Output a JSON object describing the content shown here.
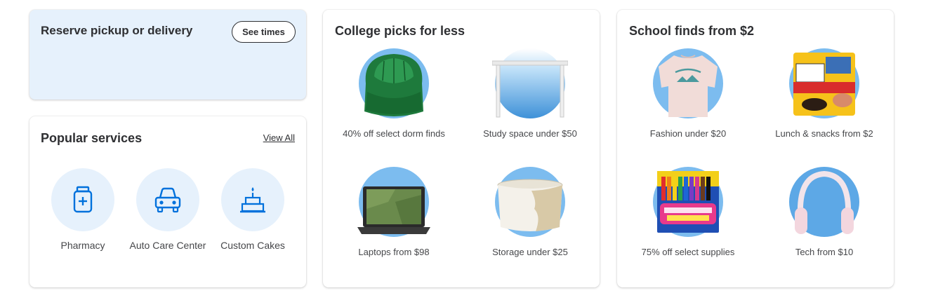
{
  "reserve": {
    "title": "Reserve pickup or delivery",
    "button_label": "See times"
  },
  "services": {
    "title": "Popular services",
    "view_all": "View All",
    "items": [
      {
        "label": "Pharmacy",
        "icon": "pill-bottle-icon"
      },
      {
        "label": "Auto Care Center",
        "icon": "car-icon"
      },
      {
        "label": "Custom Cakes",
        "icon": "cake-icon"
      }
    ]
  },
  "college": {
    "title": "College picks for less",
    "tiles": [
      {
        "label": "40% off select dorm finds",
        "image": "green-bean-bag-chair"
      },
      {
        "label": "Study space under $50",
        "image": "white-desk"
      },
      {
        "label": "Laptops from $98",
        "image": "chromebook-laptop"
      },
      {
        "label": "Storage under $25",
        "image": "fabric-storage-basket"
      }
    ]
  },
  "school": {
    "title": "School finds from $2",
    "tiles": [
      {
        "label": "Fashion under $20",
        "image": "colorado-sweatshirt"
      },
      {
        "label": "Lunch & snacks from $2",
        "image": "lunchables-pack"
      },
      {
        "label": "75% off select supplies",
        "image": "crayola-washable-markers"
      },
      {
        "label": "Tech from $10",
        "image": "pink-headphones"
      }
    ]
  },
  "colors": {
    "accent_blue": "#0071dc",
    "light_blue": "#e6f1fc",
    "tile_circle": "#7cbcef"
  }
}
